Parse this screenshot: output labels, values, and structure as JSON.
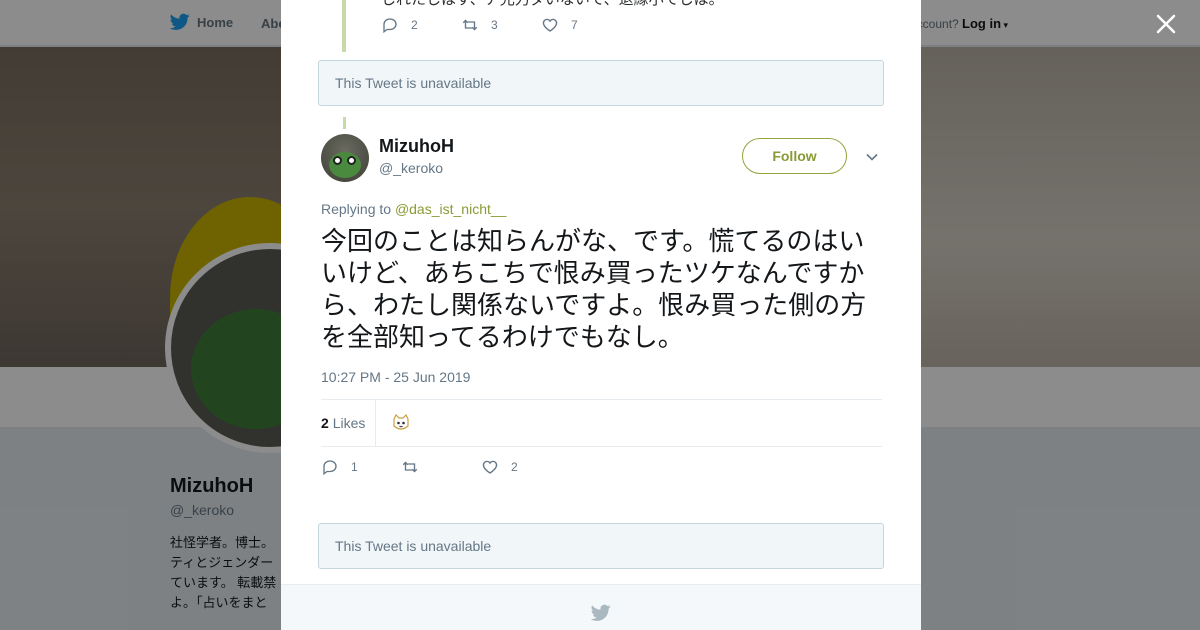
{
  "topbar": {
    "home_label": "Home",
    "about_label": "Abe",
    "account_prompt": "account?",
    "login_label": "Log in"
  },
  "profile": {
    "name": "MizuhoH",
    "handle": "@_keroko",
    "bio": "社怪学者。博士。\nティとジェンダー\nています。 転載禁\nよ。「占いをまと"
  },
  "modal": {
    "previous_tweet": {
      "text_fragment": "しれたしはす、ア允力ダいないて、退縁小てしは。",
      "reply_count": "2",
      "retweet_count": "3",
      "like_count": "7"
    },
    "unavailable_1": "This Tweet is unavailable",
    "tweet": {
      "name": "MizuhoH",
      "handle": "@_keroko",
      "follow_label": "Follow",
      "replying_prefix": "Replying to",
      "replying_to": "@das_ist_nicht__",
      "text": "今回のことは知らんがな、です。慌てるのはいいけど、あちこちで恨み買ったツケなんですから、わたし関係ないですよ。恨み買った側の方を全部知ってるわけでもなし。",
      "timestamp": "10:27 PM - 25 Jun 2019",
      "likes_count": "2",
      "likes_label": "Likes",
      "reply_count": "1",
      "retweet_count": "",
      "like_count": "2"
    },
    "unavailable_2": "This Tweet is unavailable"
  },
  "icons": {
    "close": "close-icon",
    "twitter": "twitter-bird-icon",
    "reply": "reply-icon",
    "retweet": "retweet-icon",
    "like": "heart-icon",
    "chevron": "chevron-down-icon"
  },
  "colors": {
    "accent": "#8a9a34",
    "thread_line": "#c9d9a8",
    "unavailable_bg": "#f1f6f9"
  }
}
